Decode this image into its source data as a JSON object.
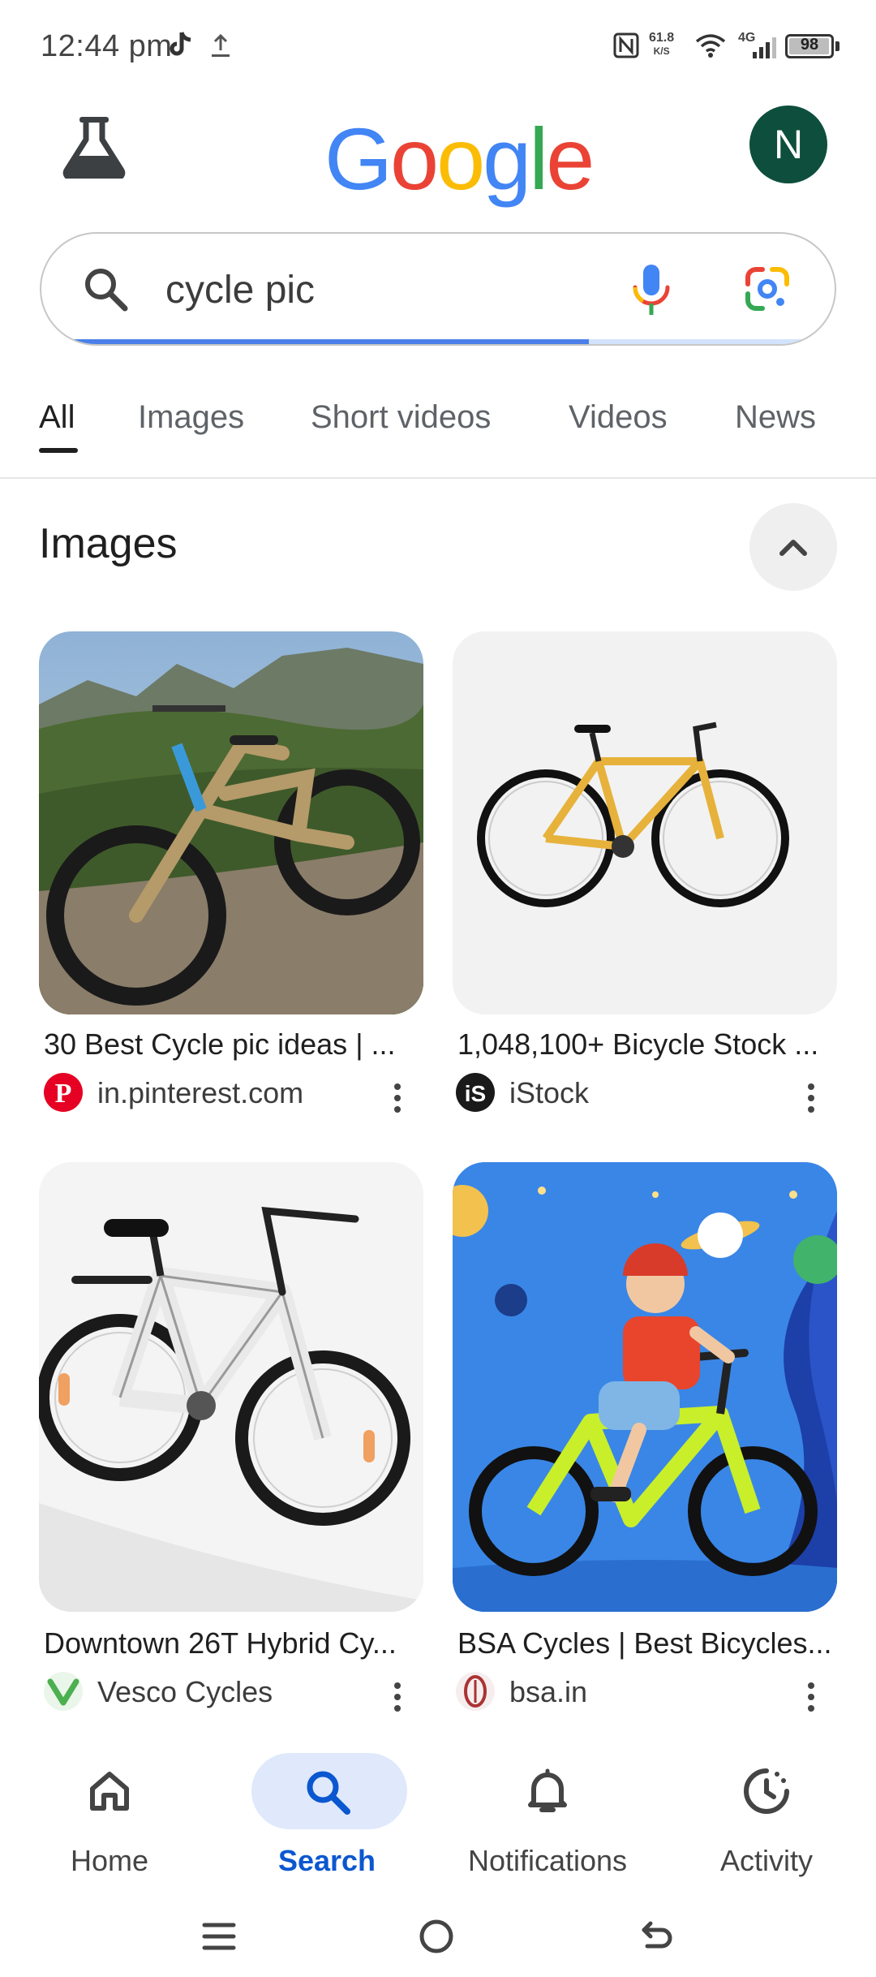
{
  "status_bar": {
    "time": "12:44 pm",
    "net_speed_value": "61.8",
    "net_speed_unit": "K/S",
    "network": "4G",
    "battery": "98"
  },
  "header": {
    "logo": "Google",
    "avatar_letter": "N"
  },
  "search": {
    "query": "cycle pic"
  },
  "tabs": [
    {
      "label": "All",
      "active": true
    },
    {
      "label": "Images"
    },
    {
      "label": "Short videos"
    },
    {
      "label": "Videos"
    },
    {
      "label": "News"
    }
  ],
  "images_section": {
    "title": "Images",
    "results": [
      {
        "title": "30 Best Cycle pic ideas | ...",
        "source": "in.pinterest.com"
      },
      {
        "title": "1,048,100+ Bicycle Stock ...",
        "source": "iStock"
      },
      {
        "title": "Downtown 26T Hybrid Cy...",
        "source": "Vesco Cycles"
      },
      {
        "title": "BSA Cycles | Best Bicycles...",
        "source": "bsa.in"
      }
    ]
  },
  "bottom_nav": [
    {
      "label": "Home",
      "icon": "home-icon"
    },
    {
      "label": "Search",
      "icon": "search-icon",
      "active": true
    },
    {
      "label": "Notifications",
      "icon": "bell-icon"
    },
    {
      "label": "Activity",
      "icon": "history-icon"
    }
  ],
  "colors": {
    "accent": "#0b57d0",
    "avatar_bg": "#0d4f3c",
    "google_blue": "#4285F4",
    "google_red": "#EA4335",
    "google_yellow": "#FBBC05",
    "google_green": "#34A853"
  }
}
